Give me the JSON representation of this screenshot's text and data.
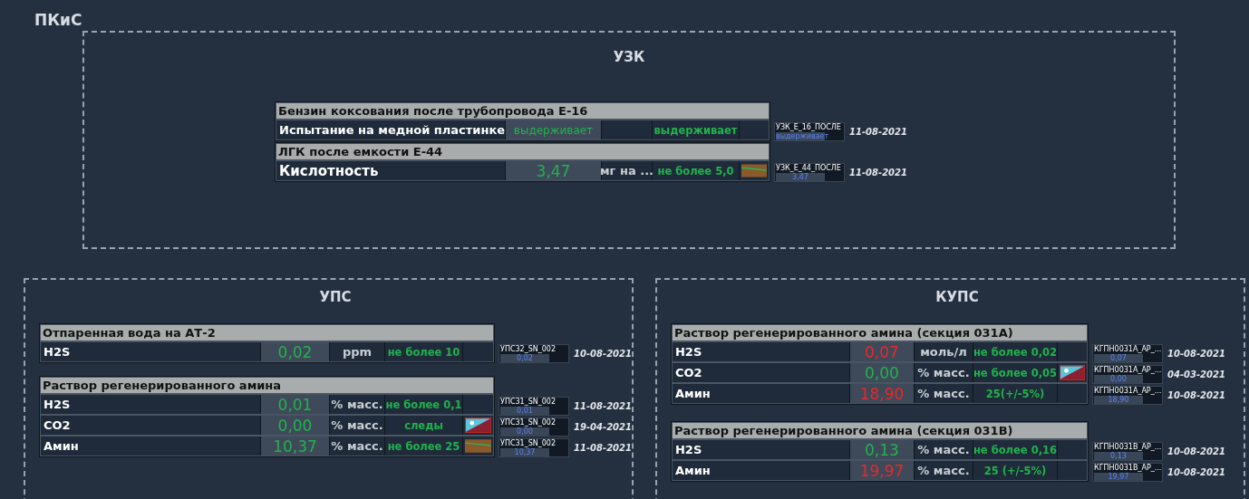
{
  "title": "ПКиС",
  "sections": [
    {
      "title": "УЗК",
      "groups": [
        {
          "header": "Бензин коксования после трубопровода Е-16",
          "rows": [
            {
              "name": "Испытание на медной пластинке",
              "value": "выдерживает",
              "alarm": false,
              "norm": "выдерживает",
              "kind": "none",
              "tag": "УЗК_Е_16_ПОСЛЕ",
              "mini_value": "выдерживает",
              "date": "11-08-2021"
            }
          ]
        },
        {
          "header": "ЛГК после емкости Е-44",
          "rows": [
            {
              "name": "Кислотность",
              "value": "3,47",
              "alarm": false,
              "unit": "мг на ...",
              "norm": "не более 5,0",
              "kind": "chart",
              "tag": "УЗК_Е_44_ПОСЛЕ",
              "mini_value": "3,47",
              "date": "11-08-2021"
            }
          ]
        }
      ]
    },
    {
      "title": "УПС",
      "groups": [
        {
          "header": "Отпаренная вода на АТ-2",
          "rows": [
            {
              "name": "H2S",
              "value": "0,02",
              "alarm": false,
              "unit": "ppm",
              "norm": "не более 10",
              "kind": "none",
              "tag": "УПС32_SN_002",
              "mini_value": "0,02",
              "date": "10-08-2021"
            }
          ]
        },
        {
          "header": "Раствор регенерированного амина",
          "rows": [
            {
              "name": "H2S",
              "value": "0,01",
              "alarm": false,
              "unit": "% масс.",
              "norm": "не более 0,1",
              "kind": "none",
              "tag": "УПС31_SN_002",
              "mini_value": "0,01",
              "date": "11-08-2021"
            },
            {
              "name": "CO2",
              "value": "0,00",
              "alarm": false,
              "unit": "% масс.",
              "norm": "следы",
              "kind": "alert",
              "tag": "УПС31_SN_002",
              "mini_value": "0,00",
              "date": "19-04-2021"
            },
            {
              "name": "Амин",
              "value": "10,37",
              "alarm": false,
              "unit": "% масс.",
              "norm": "не более 25",
              "kind": "chart",
              "tag": "УПС31_SN_002",
              "mini_value": "10,37",
              "date": "11-08-2021"
            }
          ]
        }
      ]
    },
    {
      "title": "КУПС",
      "groups": [
        {
          "header": "Раствор регенерированного амина (секция 031А)",
          "rows": [
            {
              "name": "H2S",
              "value": "0,07",
              "alarm": true,
              "unit": "моль/л",
              "norm": "не более 0,02",
              "kind": "none",
              "tag": "КГПН0031А_АР_...",
              "mini_value": "0,07",
              "date": "10-08-2021"
            },
            {
              "name": "CO2",
              "value": "0,00",
              "alarm": false,
              "unit": "% масс.",
              "norm": "не более 0,05",
              "kind": "alert",
              "tag": "КГПН0031А_АР_...",
              "mini_value": "0,00",
              "date": "04-03-2021"
            },
            {
              "name": "Амин",
              "value": "18,90",
              "alarm": true,
              "unit": "% масс.",
              "norm": "25(+/-5%)",
              "kind": "none",
              "tag": "КГПН0031А_АР_...",
              "mini_value": "18,90",
              "date": "10-08-2021"
            }
          ]
        },
        {
          "header": "Раствор регенерированного амина (секция 031В)",
          "rows": [
            {
              "name": "H2S",
              "value": "0,13",
              "alarm": false,
              "unit": "% масс.",
              "norm": "не более 0,16",
              "kind": "none",
              "tag": "КГПН0031В_АР_...",
              "mini_value": "0,13",
              "date": "10-08-2021"
            },
            {
              "name": "Амин",
              "value": "19,97",
              "alarm": true,
              "unit": "% масс.",
              "norm": "25 (+/-5%)",
              "kind": "none",
              "tag": "КГПН0031В_АР_...",
              "mini_value": "19,97",
              "date": "10-08-2021"
            }
          ]
        }
      ]
    }
  ]
}
